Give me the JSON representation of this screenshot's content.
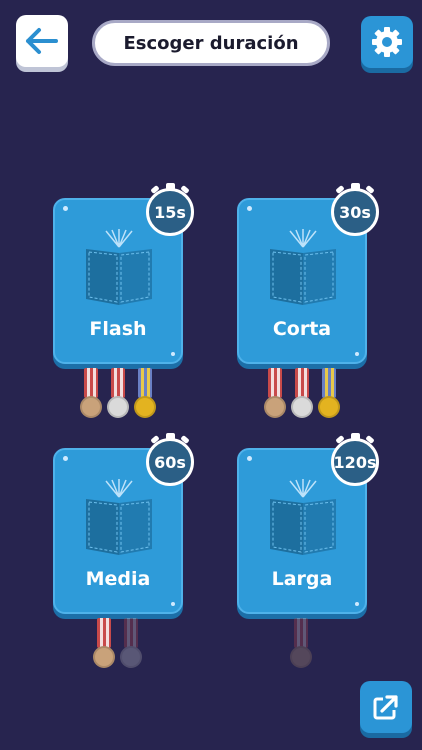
{
  "header": {
    "title": "Escoger duración",
    "back_icon": "arrow-left-icon",
    "settings_icon": "gear-icon"
  },
  "durations": [
    {
      "name": "Flash",
      "time": "15s",
      "medals": {
        "bronze": true,
        "silver": true,
        "gold": true
      }
    },
    {
      "name": "Corta",
      "time": "30s",
      "medals": {
        "bronze": true,
        "silver": true,
        "gold": true
      }
    },
    {
      "name": "Media",
      "time": "60s",
      "medals": {
        "bronze": true,
        "silver": false
      }
    },
    {
      "name": "Larga",
      "time": "120s",
      "medals": {
        "bronze": false
      }
    }
  ],
  "footer": {
    "share_icon": "share-external-icon"
  },
  "colors": {
    "background": "#27244f",
    "card": "#2e9bd9",
    "timer": "#2b5f86",
    "button_blue": "#2b95d6"
  }
}
